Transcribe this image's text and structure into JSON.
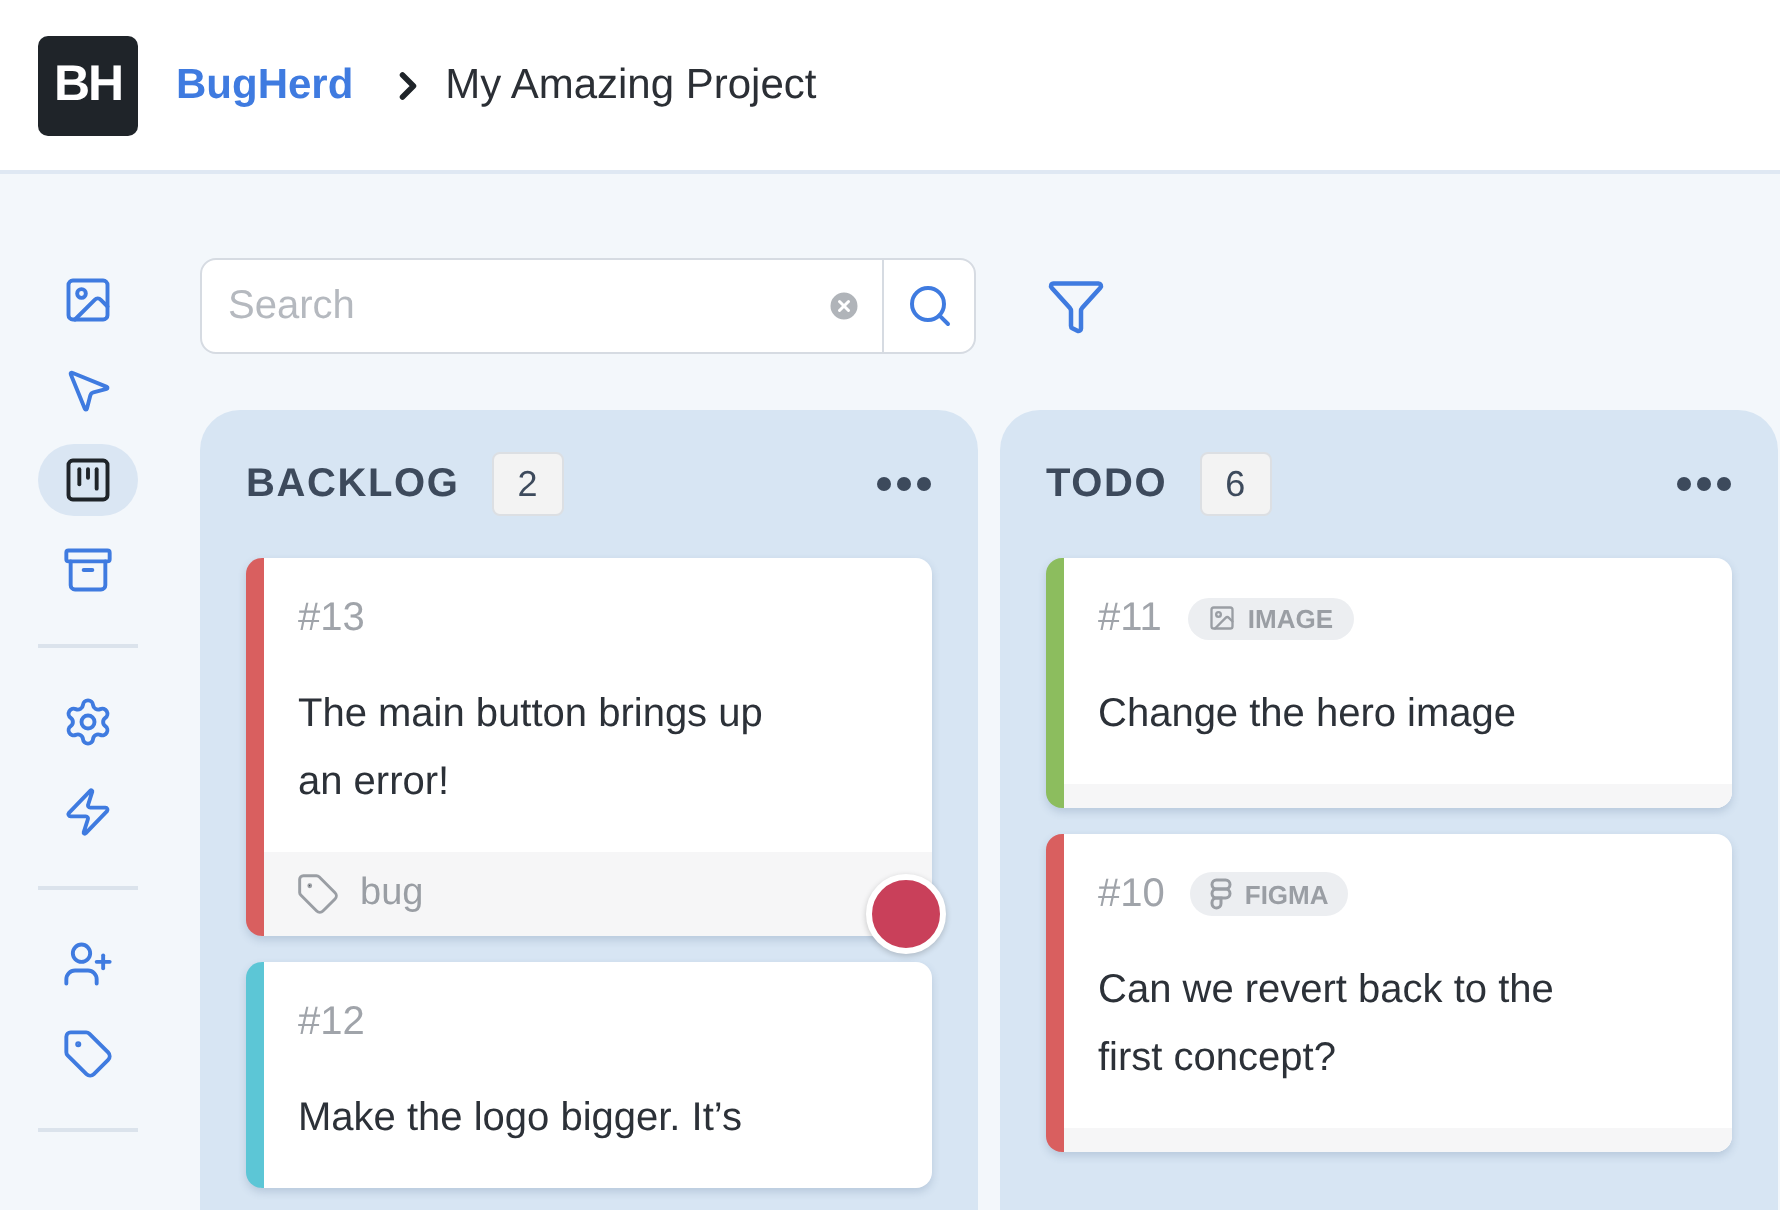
{
  "header": {
    "brand": "BugHerd",
    "project": "My Amazing Project",
    "logo_text": "BH"
  },
  "sidebar": {
    "groups": [
      [
        {
          "selected": false
        },
        {
          "selected": false
        },
        {
          "selected": true
        },
        {
          "selected": false
        }
      ],
      [
        {
          "selected": false
        },
        {
          "selected": false
        }
      ],
      [
        {
          "selected": false
        },
        {
          "selected": false
        }
      ]
    ]
  },
  "search": {
    "placeholder": "Search"
  },
  "columns": [
    {
      "title": "BACKLOG",
      "count": "2",
      "cards": [
        {
          "number": "#13",
          "title": "The main button brings up an error!",
          "color": "#d95f5f",
          "label": "bug",
          "assignee": true
        },
        {
          "number": "#12",
          "title": "Make the logo bigger. It’s",
          "color": "#5cc6d6",
          "assignee": false
        }
      ]
    },
    {
      "title": "TODO",
      "count": "6",
      "cards": [
        {
          "number": "#11",
          "tag": {
            "kind": "image",
            "text": "IMAGE"
          },
          "title": "Change the hero image",
          "color": "#8cbd5e",
          "assignee": false
        },
        {
          "number": "#10",
          "tag": {
            "kind": "figma",
            "text": "FIGMA"
          },
          "title": "Can we revert back to the first concept?",
          "color": "#d95f5f",
          "assignee": false
        }
      ]
    }
  ]
}
